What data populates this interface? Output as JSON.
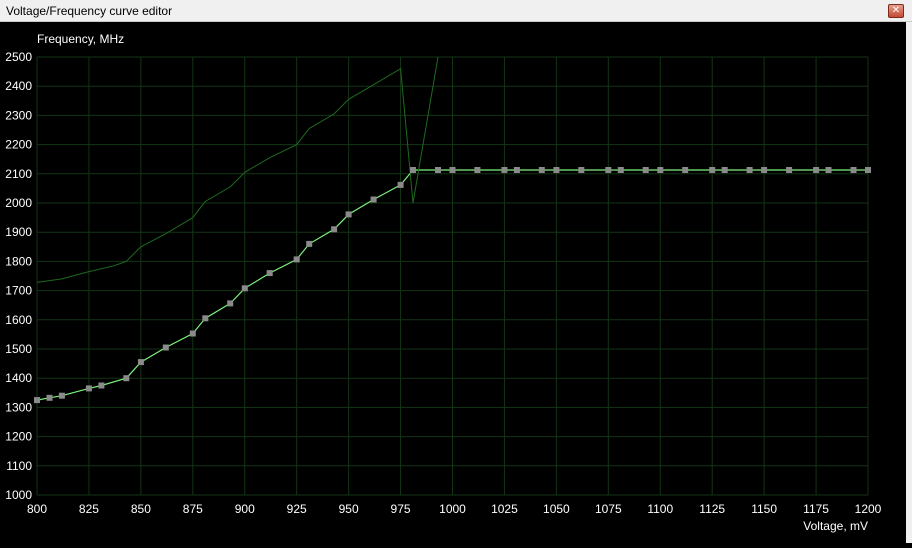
{
  "window": {
    "title": "Voltage/Frequency curve editor",
    "close_label": "✕"
  },
  "chart_data": {
    "type": "line",
    "ylabel": "Frequency, MHz",
    "xlabel": "Voltage, mV",
    "xlim": [
      800,
      1200
    ],
    "ylim": [
      1000,
      2500
    ],
    "x_ticks": [
      800,
      825,
      850,
      875,
      900,
      925,
      950,
      975,
      1000,
      1025,
      1050,
      1075,
      1100,
      1125,
      1150,
      1175,
      1200
    ],
    "y_ticks": [
      1000,
      1100,
      1200,
      1300,
      1400,
      1500,
      1600,
      1700,
      1800,
      1900,
      2000,
      2100,
      2200,
      2300,
      2400,
      2500
    ],
    "grid": true,
    "colors": {
      "background": "#000000",
      "grid": "#133413",
      "curve": "#7cf37c",
      "reference": "#1e6a1e",
      "point": "#8a8a8a",
      "text": "#ffffff"
    },
    "series": [
      {
        "role": "curve",
        "points": [
          [
            800,
            1325
          ],
          [
            806,
            1333
          ],
          [
            812,
            1340
          ],
          [
            825,
            1365
          ],
          [
            831,
            1375
          ],
          [
            843,
            1400
          ],
          [
            850,
            1455
          ],
          [
            862,
            1505
          ],
          [
            875,
            1553
          ],
          [
            881,
            1605
          ],
          [
            893,
            1656
          ],
          [
            900,
            1708
          ],
          [
            912,
            1760
          ],
          [
            925,
            1807
          ],
          [
            931,
            1860
          ],
          [
            943,
            1910
          ],
          [
            950,
            1961
          ],
          [
            962,
            2012
          ],
          [
            975,
            2062
          ],
          [
            981,
            2113
          ],
          [
            993,
            2113
          ],
          [
            1000,
            2113
          ],
          [
            1012,
            2113
          ],
          [
            1025,
            2113
          ],
          [
            1031,
            2113
          ],
          [
            1043,
            2113
          ],
          [
            1050,
            2113
          ],
          [
            1062,
            2113
          ],
          [
            1075,
            2113
          ],
          [
            1081,
            2113
          ],
          [
            1093,
            2113
          ],
          [
            1100,
            2113
          ],
          [
            1112,
            2113
          ],
          [
            1125,
            2113
          ],
          [
            1131,
            2113
          ],
          [
            1143,
            2113
          ],
          [
            1150,
            2113
          ],
          [
            1162,
            2113
          ],
          [
            1175,
            2113
          ],
          [
            1181,
            2113
          ],
          [
            1193,
            2113
          ],
          [
            1200,
            2113
          ]
        ]
      },
      {
        "role": "reference",
        "points": [
          [
            800,
            1728
          ],
          [
            812,
            1740
          ],
          [
            825,
            1765
          ],
          [
            837,
            1785
          ],
          [
            843,
            1800
          ],
          [
            850,
            1850
          ],
          [
            862,
            1895
          ],
          [
            875,
            1950
          ],
          [
            881,
            2005
          ],
          [
            893,
            2055
          ],
          [
            900,
            2105
          ],
          [
            912,
            2155
          ],
          [
            925,
            2200
          ],
          [
            931,
            2255
          ],
          [
            943,
            2305
          ],
          [
            950,
            2355
          ],
          [
            962,
            2405
          ],
          [
            975,
            2460
          ],
          [
            981,
            2000
          ],
          [
            993,
            2500
          ]
        ]
      }
    ]
  }
}
